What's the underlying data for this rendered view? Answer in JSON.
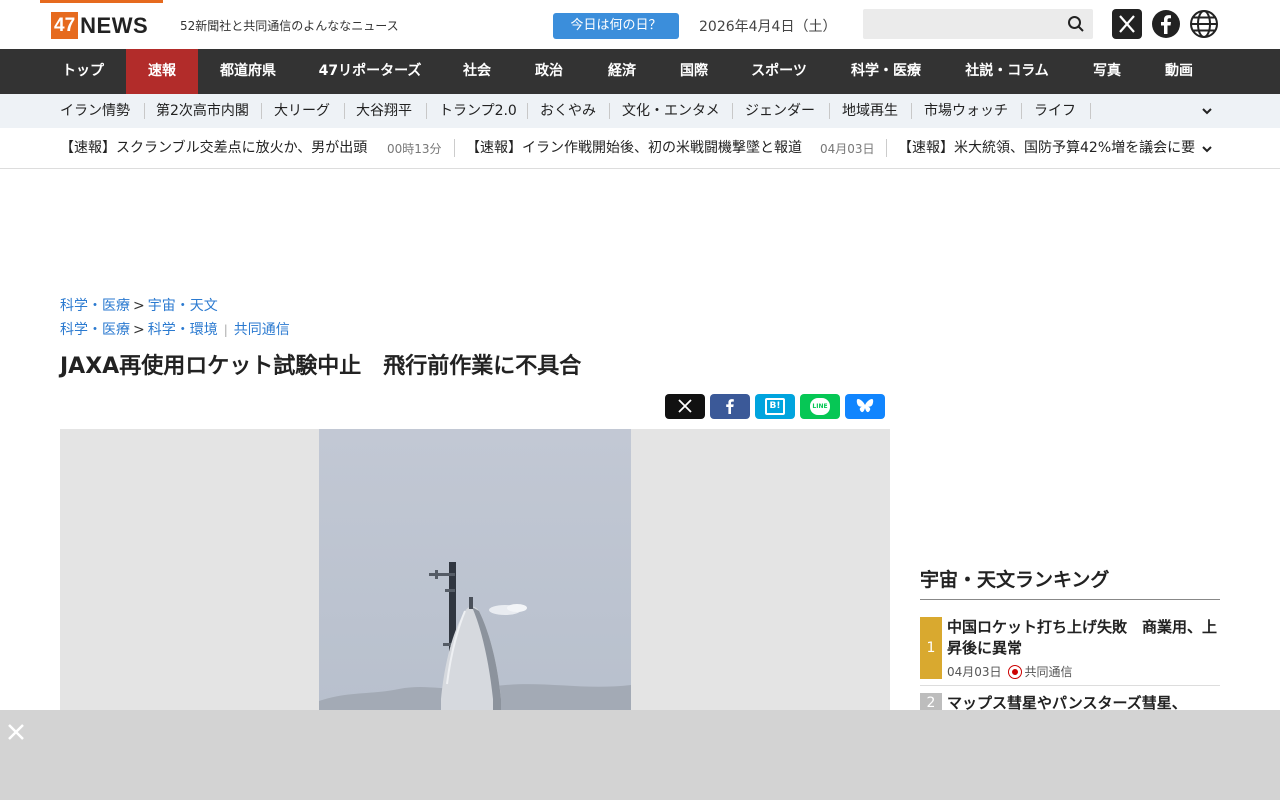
{
  "header": {
    "logo_num": "47",
    "logo_text": "NEWS",
    "tagline": "52新聞社と共同通信のよんななニュース",
    "today_button": "今日は何の日？",
    "date": "2026年4月4日（土）",
    "search_placeholder": "",
    "accent_color": "#e66a1e"
  },
  "mainnav": {
    "items": [
      {
        "label": "トップ"
      },
      {
        "label": "速報"
      },
      {
        "label": "都道府県"
      },
      {
        "label": "47リポーターズ"
      },
      {
        "label": "社会"
      },
      {
        "label": "政治"
      },
      {
        "label": "経済"
      },
      {
        "label": "国際"
      },
      {
        "label": "スポーツ"
      },
      {
        "label": "科学・医療"
      },
      {
        "label": "社説・コラム"
      },
      {
        "label": "写真"
      },
      {
        "label": "動画"
      }
    ],
    "active_index": 1,
    "active_color": "#b22c2a"
  },
  "subnav": {
    "items": [
      {
        "label": "イラン情勢"
      },
      {
        "label": "第2次高市内閣"
      },
      {
        "label": "大リーグ"
      },
      {
        "label": "大谷翔平"
      },
      {
        "label": "トランプ2.0"
      },
      {
        "label": "おくやみ"
      },
      {
        "label": "文化・エンタメ"
      },
      {
        "label": "ジェンダー"
      },
      {
        "label": "地域再生"
      },
      {
        "label": "市場ウォッチ"
      },
      {
        "label": "ライフ"
      }
    ]
  },
  "ticker": {
    "items": [
      {
        "headline": "【速報】スクランブル交差点に放火か、男が出頭",
        "time": "00時13分"
      },
      {
        "headline": "【速報】イラン作戦開始後、初の米戦闘機撃墜と報道",
        "time": "04月03日"
      },
      {
        "headline": "【速報】米大統領、国防予算42%増を議会に要",
        "time": ""
      }
    ]
  },
  "article": {
    "breadcrumb1": {
      "parent": "科学・医療",
      "child": "宇宙・天文"
    },
    "breadcrumb2": {
      "parent": "科学・医療",
      "child": "科学・環境",
      "source": "共同通信"
    },
    "title": "JAXA再使用ロケット試験中止　飛行前作業に不具合"
  },
  "share": {
    "x_color": "#111111",
    "facebook_color": "#3b5998",
    "hatena_color": "#00a4de",
    "hatena_label": "B!",
    "line_color": "#06c755",
    "line_label": "LINE",
    "bluesky_color": "#1185fe"
  },
  "sidebar": {
    "ranking_title": "宇宙・天文ランキング",
    "items": [
      {
        "rank": "1",
        "title": "中国ロケット打ち上げ失敗　商業用、上昇後に異常",
        "date": "04月03日",
        "source": "共同通信",
        "badge_color": "#d9a92f"
      },
      {
        "rank": "2",
        "title": "マップス彗星やパンスターズ彗星、",
        "badge_color": "#bdbdbd"
      }
    ]
  }
}
